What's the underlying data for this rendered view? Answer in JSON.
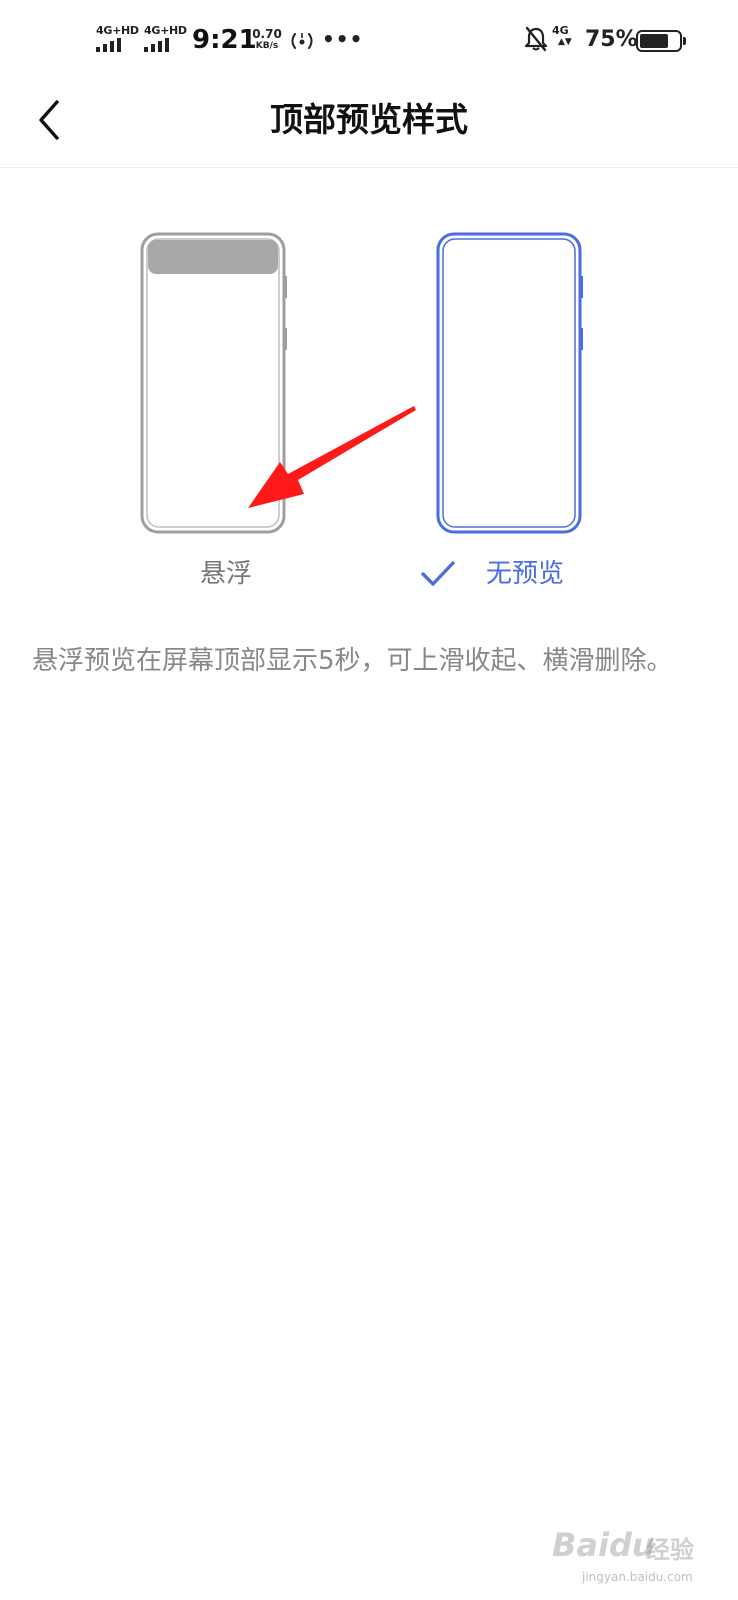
{
  "status_bar": {
    "sim1_network": "4G+HD",
    "sim2_network": "4G+HD",
    "time": "9:21",
    "net_speed_value": "0.70",
    "net_speed_unit": "KB/s",
    "more_dots": "•••",
    "data_network": "4G",
    "data_arrows": "▲▼",
    "battery_percent": "75%",
    "battery_level": 0.75,
    "icons": [
      "signal-icon",
      "hotspot-icon",
      "mute-icon",
      "battery-icon"
    ]
  },
  "header": {
    "title": "顶部预览样式",
    "back_icon": "chevron-left-icon"
  },
  "options": [
    {
      "label": "悬浮",
      "selected": false,
      "color": "#9e9e9e"
    },
    {
      "label": "无预览",
      "selected": true,
      "color": "#4a6ee0"
    }
  ],
  "description": "悬浮预览在屏幕顶部显示5秒，可上滑收起、横滑删除。",
  "watermark": {
    "brand": "Baidu",
    "brand_cn": "经验",
    "site": "jingyan.baidu.com"
  },
  "colors": {
    "accent": "#4a6ee0",
    "annotation": "#ff1a1a",
    "muted_text": "#888888"
  }
}
